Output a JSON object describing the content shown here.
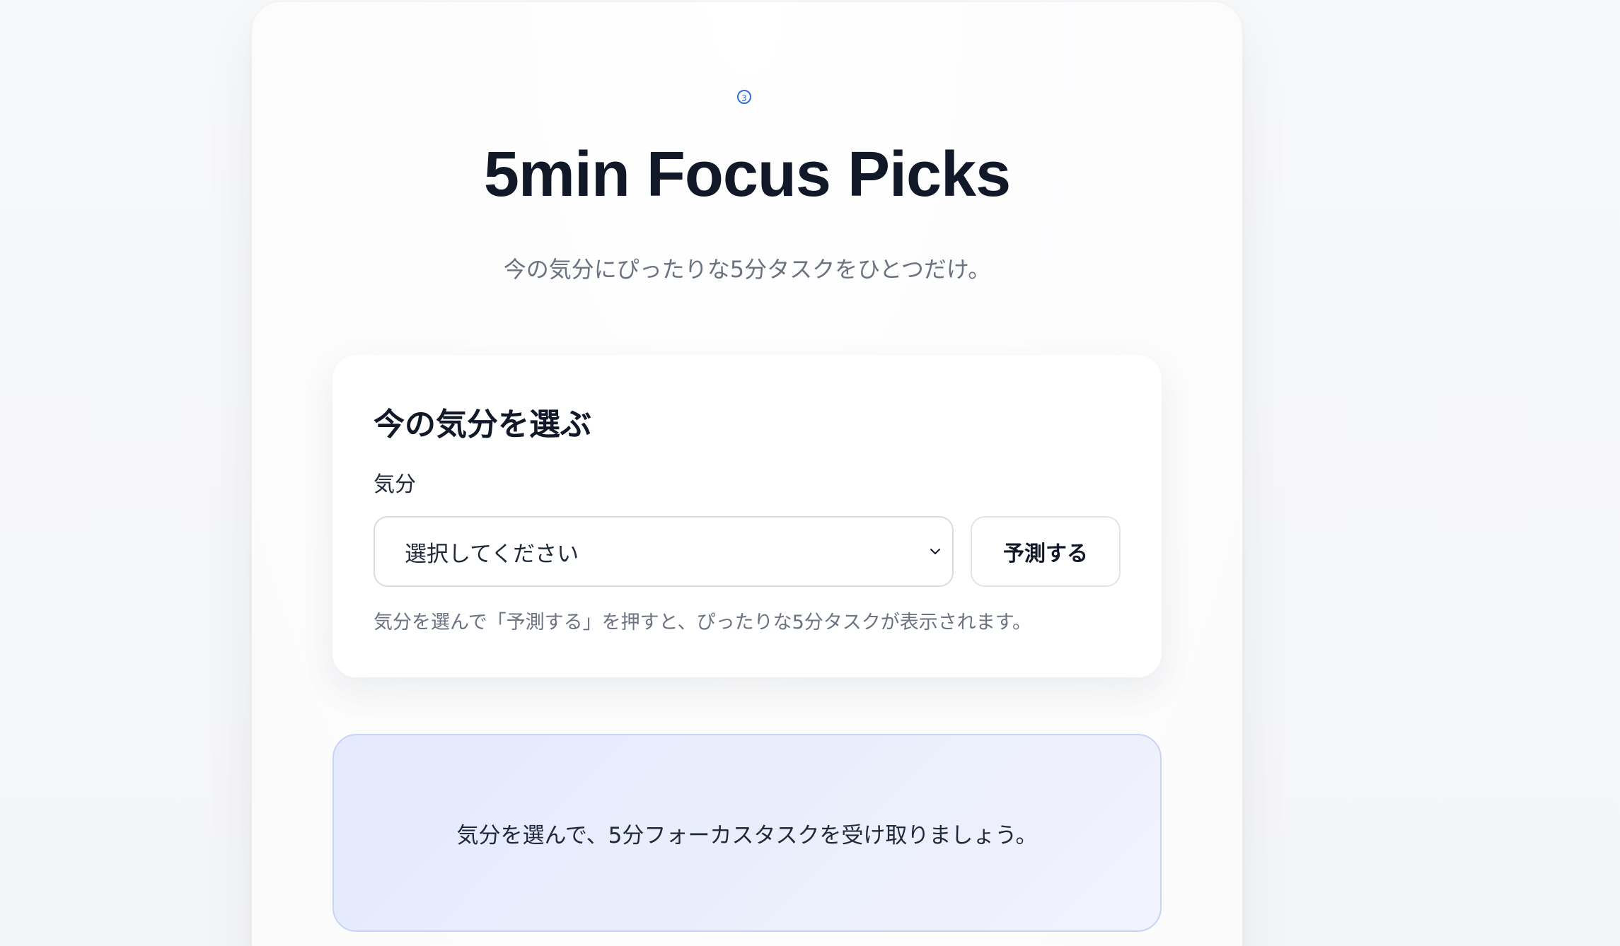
{
  "header": {
    "badge": "3",
    "title": "5min Focus Picks",
    "subtitle": "今の気分にぴったりな5分タスクをひとつだけ。"
  },
  "mood_form": {
    "heading": "今の気分を選ぶ",
    "field_label": "気分",
    "select_value": "選択してください",
    "predict_label": "予測する",
    "helper_text": "気分を選んで「予測する」を押すと、ぴったりな5分タスクが表示されます。"
  },
  "result": {
    "placeholder_text": "気分を選んで、5分フォーカスタスクを受け取りましょう。"
  },
  "colors": {
    "accent": "#2f6fd6",
    "result_bg": "#e4e9fc",
    "result_border": "#c9d3f5"
  }
}
